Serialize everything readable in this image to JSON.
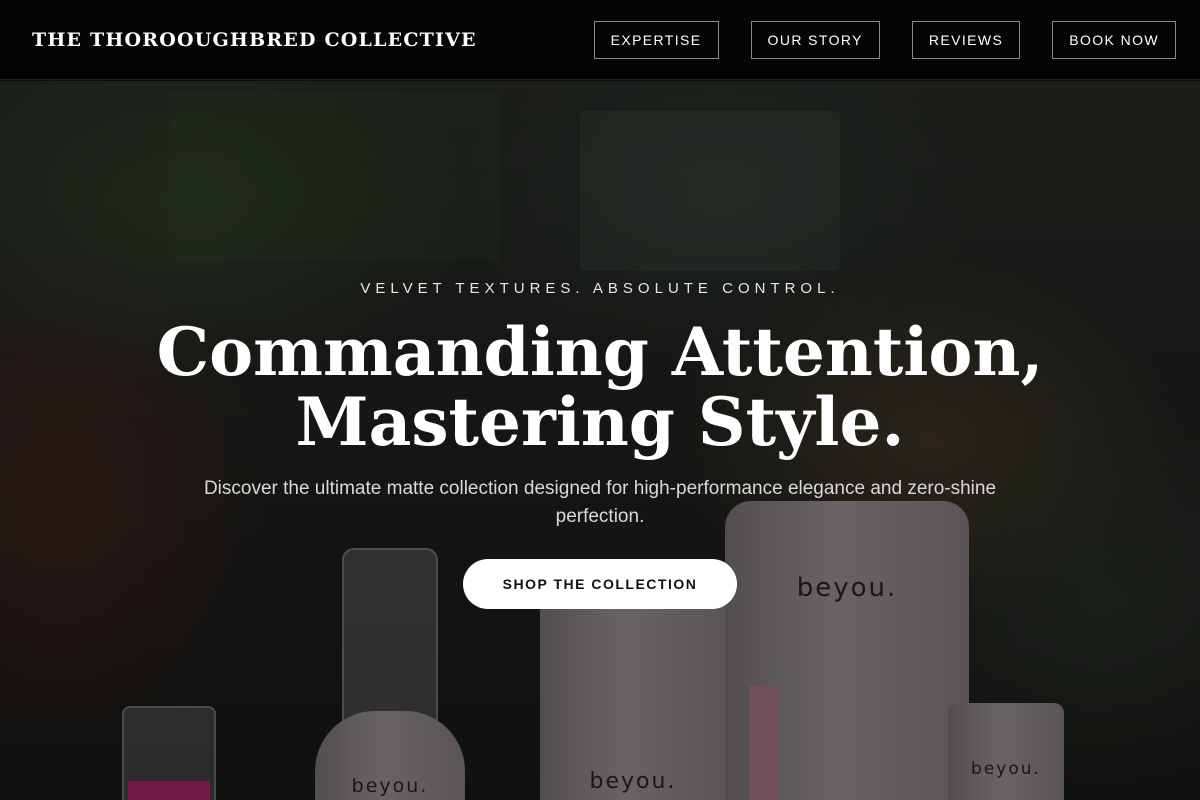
{
  "header": {
    "brand": "THE THOROOUGHBRED COLLECTIVE",
    "nav": [
      "EXPERTISE",
      "OUR STORY",
      "REVIEWS",
      "BOOK NOW"
    ]
  },
  "hero": {
    "kicker": "VELVET TEXTURES. ABSOLUTE CONTROL.",
    "headline_line1": "Commanding Attention,",
    "headline_line2": "Mastering Style.",
    "subtitle": "Discover the ultimate matte collection designed for high-performance elegance and zero-shine perfection.",
    "cta": "SHOP THE COLLECTION",
    "product_brand": "beyou."
  },
  "colors": {
    "header_bg": "#050505",
    "cta_bg": "#ffffff",
    "text": "#ffffff"
  }
}
